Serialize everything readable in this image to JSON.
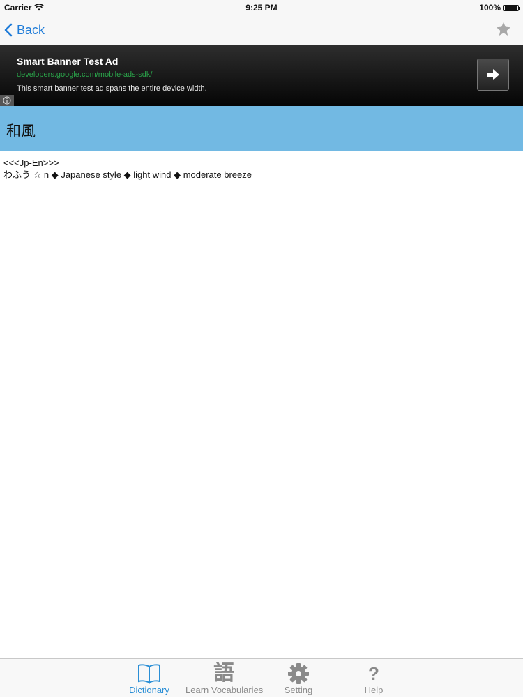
{
  "status_bar": {
    "carrier": "Carrier",
    "time": "9:25 PM",
    "battery": "100%"
  },
  "nav": {
    "back_label": "Back",
    "back_icon": "chevron-left-icon",
    "star_icon": "star-icon"
  },
  "ad": {
    "title": "Smart Banner Test Ad",
    "url": "developers.google.com/mobile-ads-sdk/",
    "description": "This smart banner test ad spans the entire device width."
  },
  "entry": {
    "word": "和風",
    "section": "<<<Jp-En>>>",
    "definition": "わふう ☆ n ◆ Japanese style ◆ light wind ◆ moderate breeze"
  },
  "tabs": [
    {
      "label": "Dictionary",
      "icon": "book-icon",
      "active": true
    },
    {
      "label": "Learn Vocabularies",
      "icon": "kanji-go-icon",
      "glyph": "語",
      "active": false
    },
    {
      "label": "Setting",
      "icon": "gear-icon",
      "active": false
    },
    {
      "label": "Help",
      "icon": "question-icon",
      "glyph": "?",
      "active": false
    }
  ],
  "colors": {
    "accent": "#1f7cd8",
    "header_bg": "#72b9e3",
    "ad_url": "#2aa44a",
    "tab_active": "#2b8fd6",
    "tab_inactive": "#8a8a8a"
  }
}
